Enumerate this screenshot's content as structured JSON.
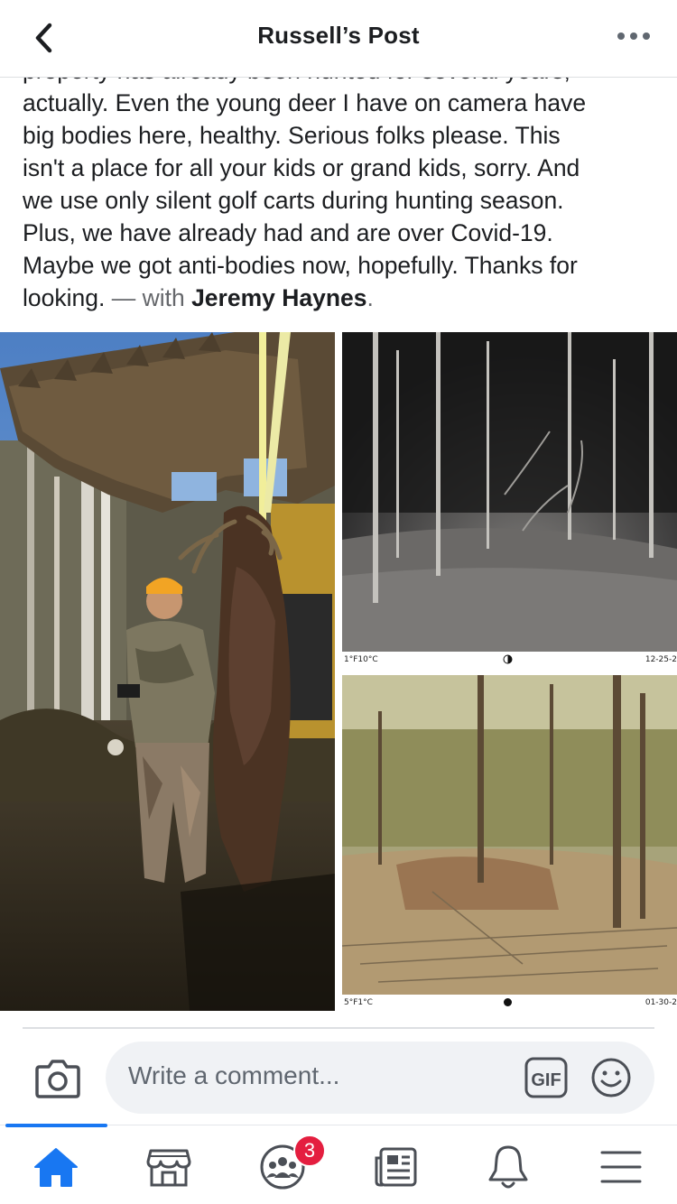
{
  "header": {
    "title": "Russell’s Post",
    "back_icon": "chevron-left-icon",
    "more_icon": "more-dots-icon"
  },
  "post": {
    "partial_first_line": "property has already been hunted for several years,",
    "lines": [
      "actually. Even the young deer I have on camera have",
      "big bodies here, healthy. Serious folks please. This",
      "isn't a place for all your kids or grand kids, sorry.  And",
      "we use only silent golf carts during hunting season.",
      "Plus, we have already had and are over Covid-19.",
      "Maybe we got anti-bodies now, hopefully. Thanks for"
    ],
    "last_line_start": "looking.",
    "with_text": " — with ",
    "tagged_name": "Jeremy Haynes",
    "period": "."
  },
  "photos": {
    "trailcam_night": {
      "temp": "1°F10°C",
      "date": "12-25-2"
    },
    "trailcam_day": {
      "temp": "5°F1°C",
      "date": "01-30-2"
    }
  },
  "comment_bar": {
    "placeholder": "Write a comment...",
    "gif_label": "GIF",
    "camera_icon": "camera-icon",
    "emoji_icon": "smiley-icon"
  },
  "bottom_nav": {
    "items": [
      "home-icon",
      "marketplace-icon",
      "groups-icon",
      "news-icon",
      "bell-icon",
      "menu-icon"
    ],
    "groups_badge": "3",
    "accent_color": "#1877f2",
    "badge_color": "#e41e3f"
  }
}
